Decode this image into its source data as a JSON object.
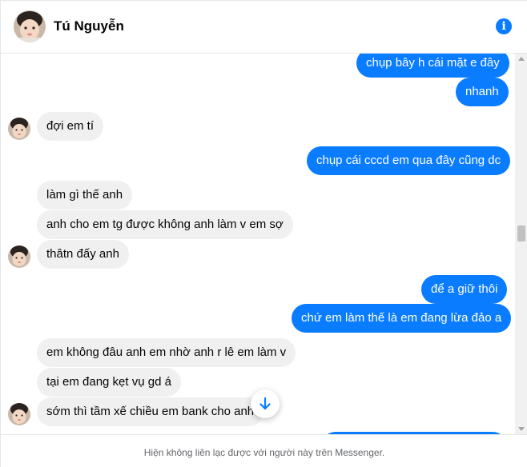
{
  "header": {
    "contact_name": "Tú Nguyễn",
    "info_icon": "info-icon",
    "info_glyph": "i"
  },
  "messages": [
    {
      "side": "out",
      "text": "chụp bây h cái mặt e đây"
    },
    {
      "side": "out",
      "text": "nhanh"
    },
    {
      "side": "in",
      "text": "đợi em tí"
    },
    {
      "side": "out",
      "text": "chụp cái cccd em qua đây cũng dc"
    },
    {
      "side": "in",
      "text": "làm gì thế anh"
    },
    {
      "side": "in",
      "text": "anh cho em tg được không anh làm v em sợ"
    },
    {
      "side": "in",
      "text": "thâtn đấy anh"
    },
    {
      "side": "out",
      "text": "để a giữ thôi"
    },
    {
      "side": "out",
      "text": "chứ em làm thế là em đang lừa đảo a"
    },
    {
      "side": "in",
      "text": "em không đâu anh em nhờ anh r lê em làm v"
    },
    {
      "side": "in",
      "text": "tại em đang kẹt vụ gd á"
    },
    {
      "side": "in",
      "text": "sớm thì tầm xế chiều em bank cho anh"
    }
  ],
  "jump_button": {
    "icon": "arrow-down-icon"
  },
  "footer": {
    "notice": "Hiện không liên lạc được với người này trên Messenger."
  },
  "colors": {
    "outgoing_bubble": "#0a7cff",
    "incoming_bubble": "#f0f0f0",
    "accent": "#0a7cff"
  }
}
